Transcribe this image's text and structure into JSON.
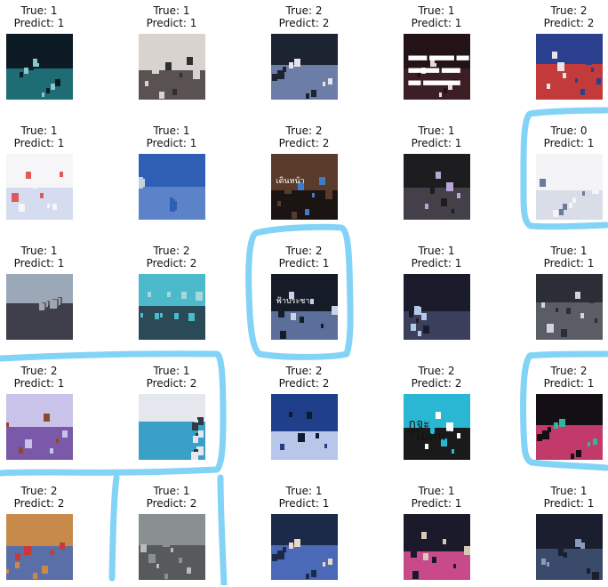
{
  "labels": {
    "true_prefix": "True: ",
    "predict_prefix": "Predict: "
  },
  "colors": {
    "highlight": "#83d3f7"
  },
  "grid": {
    "rows": 5,
    "cols": 5,
    "cells": [
      {
        "true": 1,
        "predict": 1,
        "scene": "dark-crowd-cyan",
        "colors": [
          "#0c1a24",
          "#1f6d74",
          "#8cc7d0"
        ]
      },
      {
        "true": 1,
        "predict": 1,
        "scene": "monument-crowd",
        "colors": [
          "#d9d3cf",
          "#5a5250",
          "#2f2f33"
        ]
      },
      {
        "true": 2,
        "predict": 2,
        "scene": "night-crowd",
        "colors": [
          "#1b2430",
          "#6c7ea8",
          "#e7e2ee"
        ]
      },
      {
        "true": 1,
        "predict": 1,
        "scene": "dark-text-slide",
        "colors": [
          "#241316",
          "#3c1f24",
          "#e8dad7"
        ],
        "caption": [
          "▀▀▀ ▀▀▀▀ ▀▀",
          "▀▀▀▀▀ ▀▀▀",
          "▀▀ ▀▀▀▀▀▀"
        ]
      },
      {
        "true": 2,
        "predict": 2,
        "scene": "tv-speaker",
        "colors": [
          "#2b3f8f",
          "#c23a3a",
          "#e7e5ea"
        ]
      },
      {
        "true": 1,
        "predict": 1,
        "scene": "chat-screenshot",
        "colors": [
          "#f6f6f8",
          "#d6dcef",
          "#e05a5a"
        ]
      },
      {
        "true": 1,
        "predict": 1,
        "scene": "blue-street",
        "colors": [
          "#2f5fb4",
          "#5c83c9",
          "#c7d2e0"
        ]
      },
      {
        "true": 2,
        "predict": 2,
        "scene": "flag-silhouette",
        "colors": [
          "#5a3a2b",
          "#1a1412",
          "#3f7bc9"
        ],
        "caption": [
          "เดินหน้า"
        ]
      },
      {
        "true": 1,
        "predict": 1,
        "scene": "chat-dark",
        "colors": [
          "#1d1d20",
          "#444049",
          "#b7a8d8"
        ]
      },
      {
        "true": 0,
        "predict": 1,
        "scene": "facebook-post",
        "colors": [
          "#f4f4f6",
          "#d9dde8",
          "#6a7b9b"
        ]
      },
      {
        "true": 1,
        "predict": 1,
        "scene": "street-crowd",
        "colors": [
          "#9aa8b8",
          "#3e3f4a",
          "#6c5a52"
        ]
      },
      {
        "true": 2,
        "predict": 2,
        "scene": "aerial-crowd-cyan",
        "colors": [
          "#4dbacb",
          "#2b4a57",
          "#a5d8de"
        ]
      },
      {
        "true": 2,
        "predict": 1,
        "scene": "night-protest-text",
        "colors": [
          "#161b28",
          "#5c6f9a",
          "#c9d2e6"
        ],
        "caption": [
          "ฟ้าประชา"
        ]
      },
      {
        "true": 1,
        "predict": 1,
        "scene": "night-street",
        "colors": [
          "#1a1c2c",
          "#3c3f5c",
          "#b4c8e8"
        ]
      },
      {
        "true": 1,
        "predict": 1,
        "scene": "rainy-street",
        "colors": [
          "#2b2e36",
          "#5a5d66",
          "#d0d4de"
        ]
      },
      {
        "true": 2,
        "predict": 1,
        "scene": "poster-purple",
        "colors": [
          "#c9c3ea",
          "#7a5aa8",
          "#8c4a2c"
        ]
      },
      {
        "true": 1,
        "predict": 2,
        "scene": "collage-grid",
        "colors": [
          "#e4e8ee",
          "#3aa0c8",
          "#2f3a46"
        ]
      },
      {
        "true": 2,
        "predict": 2,
        "scene": "guards-blue",
        "colors": [
          "#1f3f8a",
          "#b8c6ea",
          "#0f1a30"
        ]
      },
      {
        "true": 2,
        "predict": 2,
        "scene": "cyan-text",
        "colors": [
          "#2ab7d4",
          "#1a1a1a",
          "#ffffff"
        ],
        "caption": [
          "กูจะ",
          "\"ไม่ทน\""
        ]
      },
      {
        "true": 2,
        "predict": 1,
        "scene": "night-march",
        "colors": [
          "#140f14",
          "#c23a6a",
          "#3ab0a0"
        ]
      },
      {
        "true": 2,
        "predict": 2,
        "scene": "orange-sky-statue",
        "colors": [
          "#c88a4a",
          "#5a6ea8",
          "#c83a3a"
        ]
      },
      {
        "true": 1,
        "predict": 2,
        "scene": "gray-crowd",
        "colors": [
          "#8a9090",
          "#565a5c",
          "#b8bcbc"
        ]
      },
      {
        "true": 1,
        "predict": 1,
        "scene": "night-stage",
        "colors": [
          "#1c2a4a",
          "#4a6ab8",
          "#e8d8c8"
        ]
      },
      {
        "true": 1,
        "predict": 1,
        "scene": "night-crowd-lights",
        "colors": [
          "#1a1a2a",
          "#c84a8a",
          "#d8c8b8"
        ]
      },
      {
        "true": 1,
        "predict": 1,
        "scene": "dark-road",
        "colors": [
          "#1a1e2e",
          "#3a4a6a",
          "#8a9ab8"
        ]
      }
    ]
  }
}
